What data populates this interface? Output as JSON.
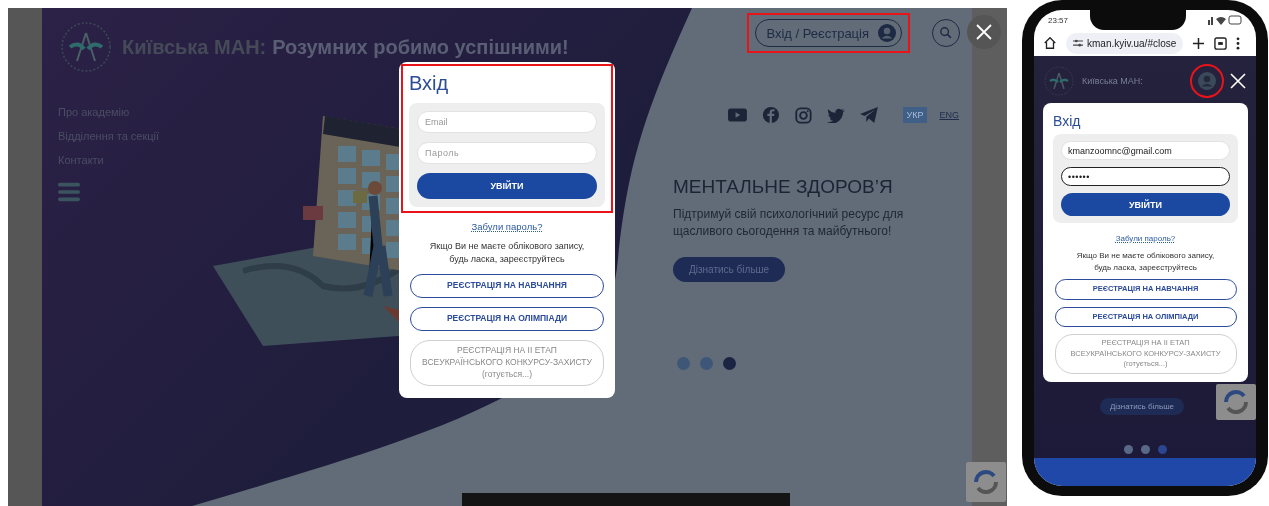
{
  "desktop": {
    "header": {
      "logo_title": "Київська МАН:",
      "logo_slogan": "Розумних робимо успішними!",
      "login_button": "Вхід / Реєстрація",
      "login_highlighted": true
    },
    "nav": [
      {
        "label": "Про академію"
      },
      {
        "label": "Відділення та секції"
      },
      {
        "label": "Контакти"
      }
    ],
    "languages": [
      {
        "label": "УКР",
        "selected": true
      },
      {
        "label": "ENG",
        "selected": false
      }
    ],
    "hero": {
      "title": "МЕНТАЛЬНЕ ЗДОРОВ’Я",
      "text": "Підтримуй свій психологічний ресурс для щасливого сьогодення та майбутнього!",
      "button": "Дізнатись більше"
    },
    "carousel_dots": [
      {
        "selected": false
      },
      {
        "selected": false
      },
      {
        "selected": true
      }
    ],
    "login_modal": {
      "title": "Вхід",
      "highlighted": true,
      "fields": [
        {
          "kind": "email",
          "placeholder": "Email",
          "focused": false
        },
        {
          "kind": "password",
          "placeholder": "Пароль",
          "focused": false
        }
      ],
      "submit": "УВІЙТИ",
      "forgot_link": "Забули пароль?",
      "note": "Якщо Ви не маєте облікового запису,\nбудь ласка, зареєструйтесь",
      "register_buttons": [
        {
          "label": "РЕЄСТРАЦІЯ НА НАВЧАННЯ",
          "disabled": false
        },
        {
          "label": "РЕЄСТРАЦІЯ НА ОЛІМПІАДИ",
          "disabled": false
        },
        {
          "label": "РЕЄСТРАЦІЯ НА ІІ ЕТАП\nВСЕУКРАЇНСЬКОГО КОНКУРСУ-ЗАХИСТУ\n(готується...)",
          "disabled": true
        }
      ]
    }
  },
  "phone": {
    "status_time": "23:57",
    "url": "kman.kyiv.ua/#close",
    "logo_title": "Київська МАН:",
    "profile_circled": true,
    "login_modal": {
      "title": "Вхід",
      "fields": [
        {
          "kind": "email",
          "value": "kmanzoomnc@gmail.com",
          "focused": false
        },
        {
          "kind": "password",
          "value": "••••••",
          "focused": true
        }
      ],
      "submit": "УВІЙТИ",
      "forgot_link": "Забули пароль?",
      "note": "Якщо Ви не маєте облікового запису,\nбудь ласка, зареєструйтесь",
      "register_buttons": [
        {
          "label": "РЕЄСТРАЦІЯ НА НАВЧАННЯ",
          "disabled": false
        },
        {
          "label": "РЕЄСТРАЦІЯ НА ОЛІМПІАДИ",
          "disabled": false
        },
        {
          "label": "РЕЄСТРАЦІЯ НА ІІ ЕТАП\nВСЕУКРАЇНСЬКОГО КОНКУРСУ-ЗАХИСТУ\n(готується...)",
          "disabled": true
        }
      ]
    },
    "hero_button": "Дізнатись більше",
    "carousel_dots": [
      {
        "selected": false
      },
      {
        "selected": false
      },
      {
        "selected": true
      }
    ]
  }
}
